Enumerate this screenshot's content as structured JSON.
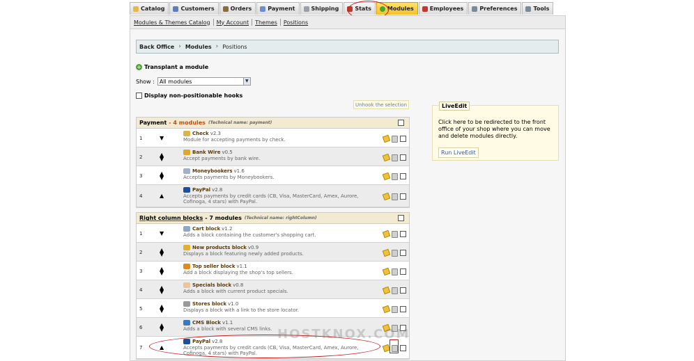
{
  "tabs": [
    {
      "label": "Catalog",
      "icon": "folder-icon",
      "color": "#e3b94a"
    },
    {
      "label": "Customers",
      "icon": "customers-icon",
      "color": "#5b7fb8"
    },
    {
      "label": "Orders",
      "icon": "orders-icon",
      "color": "#8a6d3b"
    },
    {
      "label": "Payment",
      "icon": "payment-icon",
      "color": "#6a8fd1"
    },
    {
      "label": "Shipping",
      "icon": "shipping-icon",
      "color": "#9aa0a6"
    },
    {
      "label": "Stats",
      "icon": "stats-icon",
      "color": "#c0392b"
    },
    {
      "label": "Modules",
      "icon": "modules-icon",
      "color": "#4aa534"
    },
    {
      "label": "Employees",
      "icon": "employees-icon",
      "color": "#c0392b"
    },
    {
      "label": "Preferences",
      "icon": "preferences-icon",
      "color": "#7a8a99"
    },
    {
      "label": "Tools",
      "icon": "tools-icon",
      "color": "#7a8a99"
    }
  ],
  "subnav": [
    "Modules & Themes Catalog",
    "My Account",
    "Themes",
    "Positions"
  ],
  "breadcrumb": {
    "root": "Back Office",
    "section": "Modules",
    "current": "Positions"
  },
  "transplant_label": "Transplant a module",
  "show": {
    "label": "Show :",
    "selected": "All modules"
  },
  "nonpositionable_label": "Display non-positionable hooks",
  "unhook_label": "Unhook the selection",
  "liveedit": {
    "title": "LiveEdit",
    "text": "Click here to be redirected to the front office of your shop where you can move and delete modules directly.",
    "button": "Run LiveEdit"
  },
  "hooks": [
    {
      "title": "Payment",
      "count": "- 4 modules",
      "technical": "(Technical name: payment)",
      "modules": [
        {
          "pos": "1",
          "name": "Check",
          "version": "v2.3",
          "desc": "Module for accepting payments by check.",
          "icon_color": "#d8b44a"
        },
        {
          "pos": "2",
          "name": "Bank Wire",
          "version": "v0.5",
          "desc": "Accept payments by bank wire.",
          "icon_color": "#e0a82a"
        },
        {
          "pos": "3",
          "name": "Moneybookers",
          "version": "v1.6",
          "desc": "Accepts payments by Moneybookers.",
          "icon_color": "#9fb3c8"
        },
        {
          "pos": "4",
          "name": "PayPal",
          "version": "v2.8",
          "desc": "Accepts payments by credit cards (CB, Visa, MasterCard, Amex, Aurore, Cofinoga, 4 stars) with PayPal.",
          "icon_color": "#1f4e9a"
        }
      ]
    },
    {
      "title": "Right column blocks",
      "count": "- 7 modules",
      "technical": "(Technical name: rightColumn)",
      "modules": [
        {
          "pos": "1",
          "name": "Cart block",
          "version": "v1.2",
          "desc": "Adds a block containing the customer's shopping cart.",
          "icon_color": "#8ea9c4"
        },
        {
          "pos": "2",
          "name": "New products block",
          "version": "v0.9",
          "desc": "Displays a block featuring newly added products.",
          "icon_color": "#e0b030"
        },
        {
          "pos": "3",
          "name": "Top seller block",
          "version": "v1.1",
          "desc": "Add a block displaying the shop's top sellers.",
          "icon_color": "#e08a20"
        },
        {
          "pos": "4",
          "name": "Specials block",
          "version": "v0.8",
          "desc": "Adds a block with current product specials.",
          "icon_color": "#e8c89a"
        },
        {
          "pos": "5",
          "name": "Stores block",
          "version": "v1.0",
          "desc": "Displays a block with a link to the store locator.",
          "icon_color": "#9a9a9a"
        },
        {
          "pos": "6",
          "name": "CMS Block",
          "version": "v1.1",
          "desc": "Adds a block with several CMS links.",
          "icon_color": "#3a78c2"
        },
        {
          "pos": "7",
          "name": "PayPal",
          "version": "v2.8",
          "desc": "Accepts payments by credit cards (CB, Visa, MasterCard, Amex, Aurore, Cofinoga, 4 stars) with PayPal.",
          "icon_color": "#1f4e9a"
        }
      ]
    }
  ],
  "watermark": "HOSTKNOX.COM"
}
